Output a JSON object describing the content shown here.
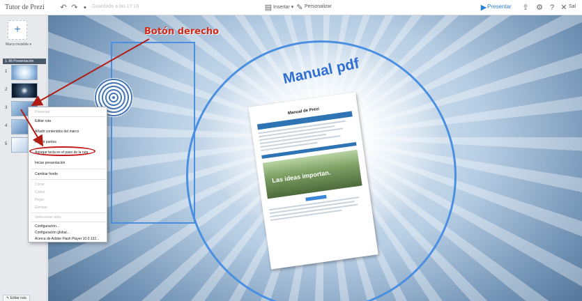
{
  "app": {
    "title": "Tutor de Prezi"
  },
  "toolbar": {
    "save_status": "Guardado a las 17:16",
    "insert_label": "Insertar ▾",
    "customize_label": "Personalizar",
    "present_label": "Presentar",
    "exit_label": "Sal"
  },
  "sidebar": {
    "add_label": "+",
    "theme_label": "Marco invisible ▾",
    "path_header": "1. Mi Presentación",
    "thumbs": [
      {
        "num": "1",
        "style": "burst"
      },
      {
        "num": "2",
        "style": "dark"
      },
      {
        "num": "3",
        "style": "blue"
      },
      {
        "num": "4",
        "style": "blue"
      },
      {
        "num": "5",
        "style": "light"
      }
    ],
    "edit_path_label": "Editar ruta"
  },
  "canvas": {
    "heading": "Manual pdf",
    "doc_title": "Manual de Prezi",
    "doc_image_text": "Las ideas importan."
  },
  "context_menu": {
    "items": [
      {
        "label": "Presentar",
        "disabled": true
      },
      {
        "label": "Editar ruta",
        "disabled": false
      },
      {
        "label": "Añadir contenidos del marco",
        "disabled": false
      },
      {
        "label": "Añadir puntos",
        "disabled": false
      },
      {
        "label": "Agregar tecla en el paso de la ruta",
        "disabled": false
      },
      {
        "label": "Iniciar presentación",
        "disabled": false
      },
      {
        "label": "Cambiar fondo",
        "disabled": false
      },
      {
        "label": "Cortar",
        "disabled": true
      },
      {
        "label": "Copiar",
        "disabled": true
      },
      {
        "label": "Pegar",
        "disabled": true
      },
      {
        "label": "Eliminar",
        "disabled": true
      },
      {
        "label": "Seleccionar todo",
        "disabled": true
      },
      {
        "label": "Configuración...",
        "disabled": false
      },
      {
        "label": "Configuración global...",
        "disabled": false
      },
      {
        "label": "Acerca de Adobe Flash Player 10.0.132...",
        "disabled": false
      }
    ]
  },
  "annotation": {
    "label": "Botón derecho"
  },
  "colors": {
    "accent": "#2d7fd6",
    "annotation": "#d42a1a"
  }
}
